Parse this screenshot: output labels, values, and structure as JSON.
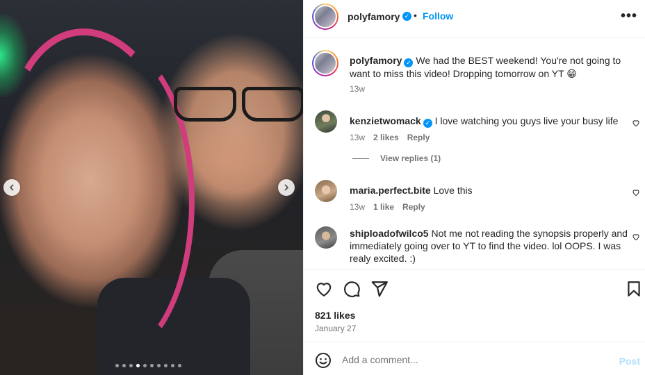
{
  "carousel": {
    "prev_icon": "chevron-left-icon",
    "next_icon": "chevron-right-icon",
    "dot_count": 10,
    "active_dot": 4
  },
  "header": {
    "username": "polyfamory",
    "separator": "•",
    "follow_label": "Follow",
    "more_label": "•••"
  },
  "caption": {
    "username": "polyfamory",
    "text": "We had the BEST weekend! You're not going to want to miss this video! Dropping tomorrow on YT 😁",
    "time": "13w"
  },
  "comments": [
    {
      "username": "kenzietwomack",
      "verified": true,
      "text": "I love watching you guys live your busy life",
      "time": "13w",
      "likes": "2 likes",
      "reply": "Reply",
      "view_replies": "View replies (1)"
    },
    {
      "username": "maria.perfect.bite",
      "verified": false,
      "text": "Love this",
      "time": "13w",
      "likes": "1 like",
      "reply": "Reply"
    },
    {
      "username": "shiploadofwilco5",
      "verified": false,
      "text": "Not me not reading the synopsis properly and immediately going over to YT to find the video. lol OOPS. I was realy excited. :)"
    }
  ],
  "actions": {
    "icons": [
      "heart-icon",
      "comment-icon",
      "share-icon",
      "bookmark-icon"
    ],
    "likes": "821 likes",
    "date": "January 27"
  },
  "add_comment": {
    "placeholder": "Add a comment...",
    "post_label": "Post"
  },
  "colors": {
    "accent": "#0095f6",
    "post_disabled": "#b2dffc",
    "muted": "#737373",
    "hair": "#d13c7c"
  }
}
